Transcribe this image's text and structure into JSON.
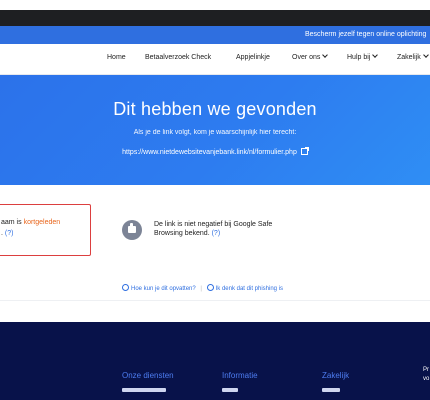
{
  "banner": {
    "text": "Bescherm jezelf tegen online oplichting"
  },
  "nav": {
    "items": [
      {
        "label": "Home"
      },
      {
        "label": "Betaalverzoek Check"
      },
      {
        "label": "Appjelinkje"
      },
      {
        "label": "Over ons"
      },
      {
        "label": "Hulp bij"
      },
      {
        "label": "Zakelijk"
      }
    ]
  },
  "hero": {
    "title": "Dit hebben we gevonden",
    "subtitle": "Als je de link volgt, kom je waarschijnlijk hier terecht:",
    "url": "https://www.nietdewebsitevanjebank.link/nl/formulier.php"
  },
  "results": {
    "left": {
      "line1_prefix": "aam is ",
      "line1_highlight": "kortgeleden",
      "line2_prefix": ". ",
      "line2_link": "(?)"
    },
    "right": {
      "line1": "De link is niet negatief bij Google Safe",
      "line2_prefix": "Browsing bekend. ",
      "line2_link": "(?)"
    }
  },
  "help_links": {
    "left": "Hoe kun je dit opvatten?",
    "separator": "|",
    "right": "Ik denk dat dit phishing is"
  },
  "footer": {
    "columns": [
      {
        "title": "Onze diensten"
      },
      {
        "title": "Informatie"
      },
      {
        "title": "Zakelijk"
      }
    ],
    "edge_text": {
      "line1": "Pr",
      "line2": "vo"
    }
  },
  "colors": {
    "brand_blue": "#2f6fe0",
    "hero_blue": "#2d7cf0",
    "footer_navy": "#08124a",
    "warning_red": "#dc3f3f",
    "accent_orange": "#e8651b",
    "footer_heading": "#4d7cf0"
  },
  "icons": {
    "nav_dropdown": "chevron-down-icon",
    "url_link": "external-link-icon",
    "result": "thumbs-up-icon",
    "help": "info-circle-icon",
    "phishing": "warning-icon"
  }
}
